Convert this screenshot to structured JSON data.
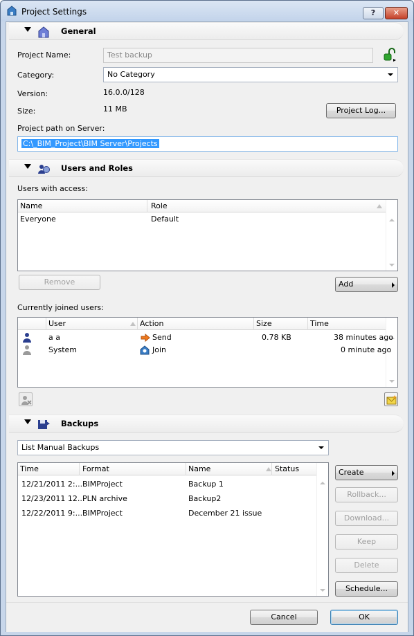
{
  "window": {
    "title": "Project Settings",
    "help_label": "?",
    "close_label": "✕"
  },
  "general": {
    "title": "General",
    "project_name_label": "Project Name:",
    "project_name_value": "Test backup",
    "category_label": "Category:",
    "category_value": "No Category",
    "version_label": "Version:",
    "version_value": "16.0.0/128",
    "size_label": "Size:",
    "size_value": "11 MB",
    "project_log_button": "Project Log...",
    "path_label": "Project path on Server:",
    "path_value": "C:\\_BIM_Project\\BIM Server\\Projects"
  },
  "users_roles": {
    "title": "Users and Roles",
    "access_label": "Users with access:",
    "columns": [
      "Name",
      "Role"
    ],
    "rows": [
      {
        "name": "Everyone",
        "role": "Default"
      }
    ],
    "remove_button": "Remove",
    "add_button": "Add",
    "joined_label": "Currently joined users:",
    "joined_columns": [
      "User",
      "Action",
      "Size",
      "Time"
    ],
    "joined_rows": [
      {
        "user": "a a",
        "action": "Send",
        "size": "0.78 KB",
        "time": "38 minutes ago"
      },
      {
        "user": "System",
        "action": "Join",
        "size": "",
        "time": "0 minute ago"
      }
    ]
  },
  "backups": {
    "title": "Backups",
    "filter_value": "List Manual Backups",
    "columns": [
      "Time",
      "Format",
      "Name",
      "Status"
    ],
    "rows": [
      {
        "time": "12/21/2011 2:...",
        "format": "BIMProject",
        "name": "Backup 1",
        "status": ""
      },
      {
        "time": "12/23/2011 12...",
        "format": "PLN archive",
        "name": "Backup2",
        "status": ""
      },
      {
        "time": "12/22/2011 9:...",
        "format": "BIMProject",
        "name": "December 21 issue",
        "status": ""
      }
    ],
    "create_button": "Create",
    "rollback_button": "Rollback...",
    "download_button": "Download...",
    "keep_button": "Keep",
    "delete_button": "Delete",
    "schedule_button": "Schedule..."
  },
  "footer": {
    "cancel_button": "Cancel",
    "ok_button": "OK"
  },
  "colors": {
    "selection": "#3399ff",
    "title_bar": "#c7d6ea",
    "close_button": "#c5412a"
  }
}
